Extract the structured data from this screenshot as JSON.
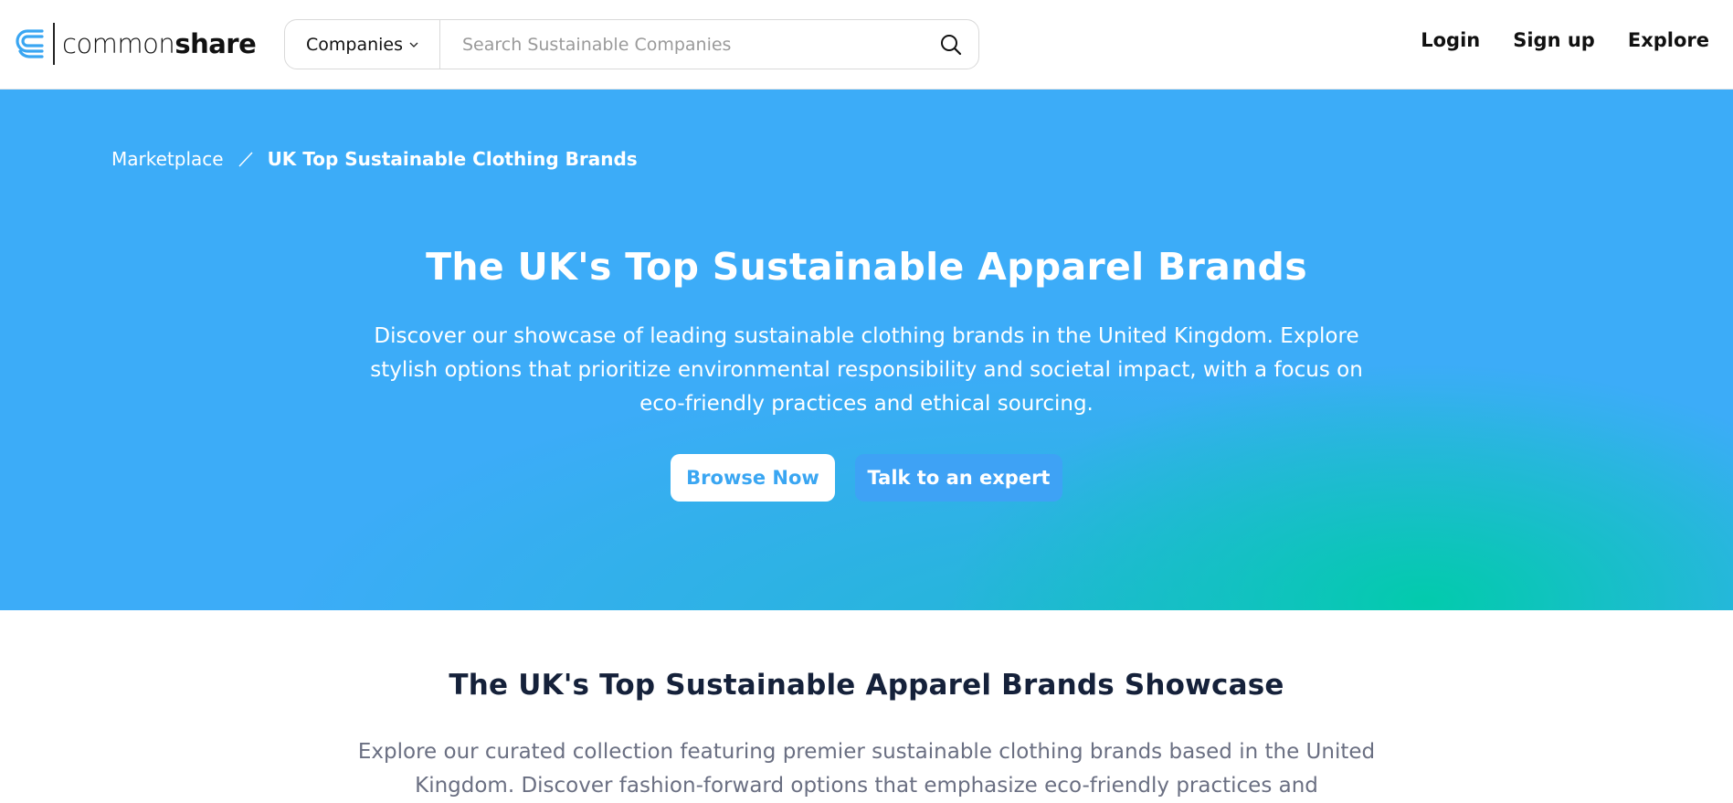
{
  "header": {
    "logo": {
      "part1": "common",
      "part2": "share"
    },
    "search": {
      "category": "Companies",
      "placeholder": "Search Sustainable Companies"
    },
    "nav": {
      "login": "Login",
      "signup": "Sign up",
      "explore": "Explore"
    }
  },
  "hero": {
    "breadcrumb": {
      "home": "Marketplace",
      "current": "UK Top Sustainable Clothing Brands"
    },
    "title": "The UK's Top Sustainable Apparel Brands",
    "description": "Discover our showcase of leading sustainable clothing brands in the United Kingdom. Explore stylish options that prioritize environmental responsibility and societal impact, with a focus on eco-friendly practices and ethical sourcing.",
    "buttons": {
      "browse": "Browse Now",
      "expert": "Talk to an expert"
    }
  },
  "showcase": {
    "title": "The UK's Top Sustainable Apparel Brands Showcase",
    "description": "Explore our curated collection featuring premier sustainable clothing brands based in the United Kingdom. Discover fashion-forward options that emphasize eco-friendly practices and"
  },
  "colors": {
    "hero_blue": "#3cacf8",
    "hero_teal": "#00ccaa",
    "logo_blue": "#3aa6f2",
    "title_dark": "#15213a"
  },
  "icons": {
    "logo": "commonshare-logo-mark",
    "chevron": "chevron-down-icon",
    "search": "search-icon",
    "separator": "slash-separator-icon"
  }
}
